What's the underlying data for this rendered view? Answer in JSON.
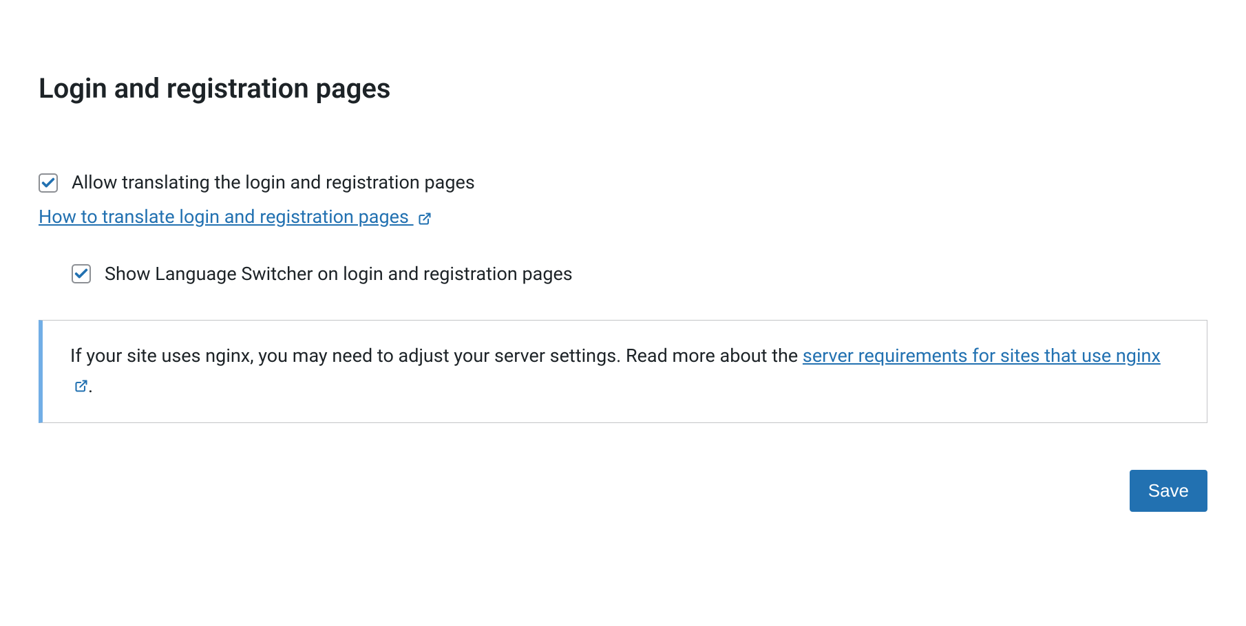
{
  "heading": "Login and registration pages",
  "option1": {
    "label": "Allow translating the login and registration pages",
    "checked": true
  },
  "helpLink": {
    "text": "How to translate login and registration pages "
  },
  "option2": {
    "label": "Show Language Switcher on login and registration pages",
    "checked": true
  },
  "notice": {
    "prefix": "If your site uses nginx, you may need to adjust your server settings. Read more about the ",
    "linkText": "server requirements for sites that use nginx ",
    "suffix": "."
  },
  "saveLabel": "Save",
  "colors": {
    "link": "#2271b1",
    "checkmark": "#2271b1"
  }
}
